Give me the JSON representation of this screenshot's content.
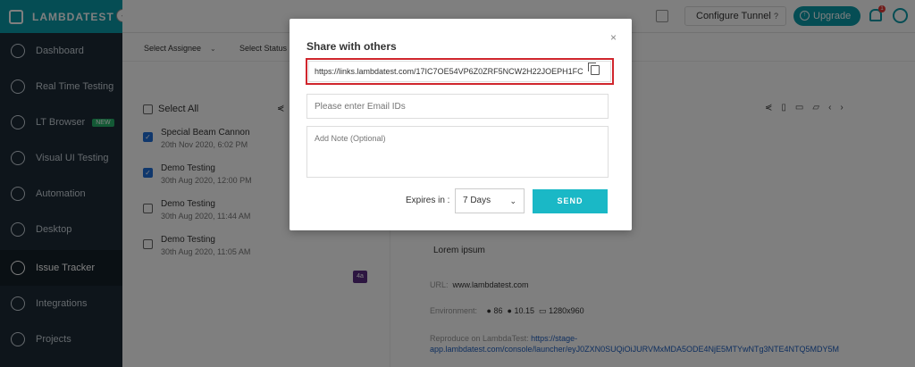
{
  "sidebar": {
    "logo": "LAMBDATEST",
    "collapse_icon": "‹",
    "items": [
      {
        "label": "Dashboard",
        "icon": "dashboard-icon"
      },
      {
        "label": "Real Time Testing",
        "icon": "realtime-icon"
      },
      {
        "label": "LT Browser",
        "icon": "browser-icon",
        "badge": "NEW"
      },
      {
        "label": "Visual UI Testing",
        "icon": "visual-icon"
      },
      {
        "label": "Automation",
        "icon": "automation-icon"
      },
      {
        "label": "Desktop",
        "icon": "desktop-icon"
      },
      {
        "label": "Issue Tracker",
        "icon": "issue-tracker-icon",
        "active": true
      },
      {
        "label": "Integrations",
        "icon": "integrations-icon"
      },
      {
        "label": "Projects",
        "icon": "projects-icon"
      }
    ]
  },
  "topbar": {
    "configure_tunnel": "Configure Tunnel",
    "configure_help": "?",
    "upgrade_label": "Upgrade",
    "notification_count": "1"
  },
  "filters": {
    "assignee": "Select Assignee",
    "status": "Select Status"
  },
  "list": {
    "select_all": "Select All",
    "issues": [
      {
        "title": "Special Beam Cannon",
        "date": "20th Nov 2020, 6:02 PM",
        "checked": true
      },
      {
        "title": "Demo Testing",
        "date": "30th Aug 2020, 12:00 PM",
        "checked": true
      },
      {
        "title": "Demo Testing",
        "date": "30th Aug 2020, 11:44 AM",
        "checked": false
      },
      {
        "title": "Demo Testing",
        "date": "30th Aug 2020, 11:05 AM",
        "checked": false
      }
    ],
    "tag": "4a"
  },
  "detail": {
    "lorem": "Lorem ipsum",
    "url_label": "URL:",
    "url_value": "www.lambdatest.com",
    "env_label": "Environment:",
    "env_browser": "86",
    "env_os": "10.15",
    "env_resolution": "1280x960",
    "repro_label": "Reproduce on LambdaTest:",
    "repro_link": "https://stage-app.lambdatest.com/console/launcher/eyJ0ZXN0SUQiOiJURVMxMDA5ODE4NjE5MTYwNTg3NTE4NTQ5MDY5M"
  },
  "modal": {
    "title": "Share with others",
    "close": "×",
    "share_link": "https://links.lambdatest.com/17IC7OE54VP6Z0ZRF5NCW2H22JOEPH1FC",
    "email_placeholder": "Please enter Email IDs",
    "note_placeholder": "Add Note (Optional)",
    "expires_label": "Expires in :",
    "expires_value": "7 Days",
    "send_label": "SEND"
  },
  "colors": {
    "brand": "#0b9aa8",
    "send": "#1ab8c6",
    "highlight": "#d0262d",
    "sidebar_bg": "#1c2a36"
  }
}
